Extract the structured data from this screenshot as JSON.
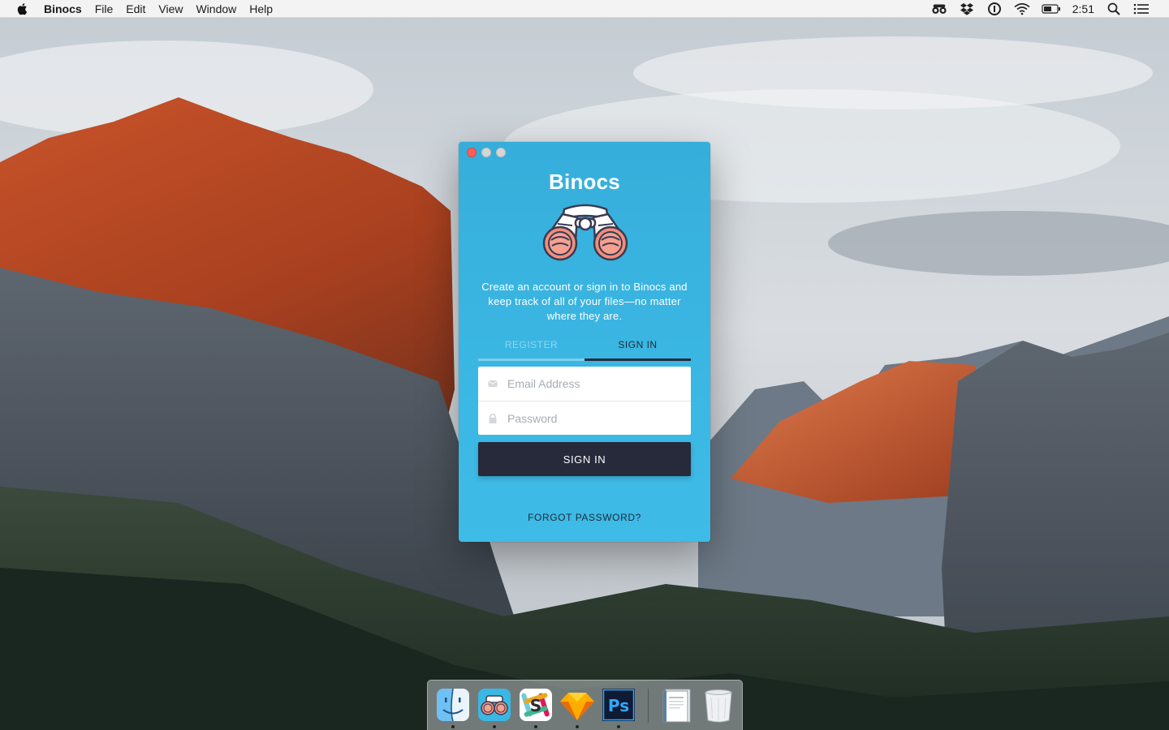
{
  "menubar": {
    "app_name": "Binocs",
    "items": [
      "File",
      "Edit",
      "View",
      "Window",
      "Help"
    ],
    "clock": "2:51",
    "status_icons": [
      "binoculars-icon",
      "dropbox-icon",
      "onepassword-icon",
      "wifi-icon",
      "battery-icon",
      "spotlight-search-icon",
      "notification-center-icon"
    ]
  },
  "window": {
    "app_title": "Binocs",
    "tagline": "Create an account or sign in to Binocs and keep track of all of your files—no matter where they are.",
    "tabs": [
      {
        "label": "REGISTER",
        "active": false
      },
      {
        "label": "SIGN IN",
        "active": true
      }
    ],
    "email": {
      "placeholder": "Email Address",
      "value": ""
    },
    "password": {
      "placeholder": "Password",
      "value": ""
    },
    "signin_button": "SIGN IN",
    "forgot_link": "FORGOT PASSWORD?"
  },
  "dock": {
    "apps": [
      {
        "name": "finder-icon",
        "running": true
      },
      {
        "name": "binocs-icon",
        "running": true
      },
      {
        "name": "slack-icon",
        "running": true
      },
      {
        "name": "sketch-icon",
        "running": true
      },
      {
        "name": "photoshop-icon",
        "label": "Ps",
        "running": true
      },
      {
        "name": "document-icon",
        "running": false
      },
      {
        "name": "trash-icon",
        "running": false
      }
    ]
  },
  "colors": {
    "window_bg": "#3bb7e3",
    "signin_button_bg": "#262a3b",
    "close_button": "#fc5f57"
  }
}
